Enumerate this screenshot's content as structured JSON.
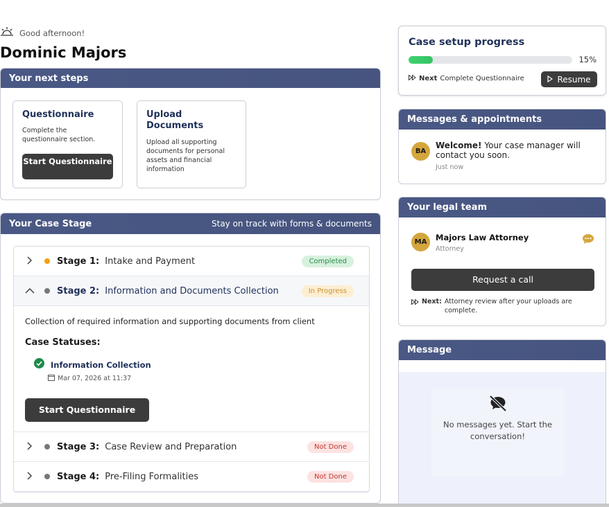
{
  "greeting": "Good afternoon!",
  "user_name": "Dominic Majors",
  "next_steps": {
    "title": "Your next steps",
    "cards": [
      {
        "title": "Questionnaire",
        "desc": "Complete the questionnaire section.",
        "button": "Start Questionnaire"
      },
      {
        "title": "Upload Documents",
        "desc": "Upload all supporting documents for personal assets and financial information"
      }
    ]
  },
  "case_stage": {
    "title": "Your Case Stage",
    "subtitle": "Stay on track with forms & documents",
    "stages": [
      {
        "label": "Stage 1:",
        "name": "Intake and Payment",
        "status": "Completed"
      },
      {
        "label": "Stage 2:",
        "name": "Information and Documents Collection",
        "status": "In Progress"
      },
      {
        "label": "Stage 3:",
        "name": "Case Review and Preparation",
        "status": "Not Done"
      },
      {
        "label": "Stage 4:",
        "name": "Pre-Filing Formalities",
        "status": "Not Done"
      }
    ],
    "expanded": {
      "description": "Collection of required information and supporting documents from client",
      "statuses_title": "Case Statuses:",
      "status_item": "Information Collection",
      "status_date": "Mar 07, 2026 at 11:37",
      "button": "Start Questionnaire"
    }
  },
  "progress": {
    "title": "Case setup progress",
    "percent_label": "15%",
    "percent": 15,
    "next_label": "Next",
    "next_text": "Complete Questionnaire",
    "resume": "Resume"
  },
  "messages": {
    "title": "Messages & appointments",
    "avatar": "BA",
    "welcome_bold": "Welcome!",
    "welcome_text": "Your case manager will contact you soon.",
    "time": "Just now"
  },
  "legal_team": {
    "title": "Your legal team",
    "avatar": "MA",
    "name": "Majors Law Attorney",
    "role": "Attorney",
    "button": "Request a call",
    "next_label": "Next:",
    "next_text": "Attorney review after your uploads are complete."
  },
  "message_panel": {
    "title": "Message",
    "empty_text": "No messages yet. Start the conversation!"
  },
  "colors": {
    "header": "#4a5885",
    "accent_green": "#3ec96b",
    "dark_button": "#3c3c3c",
    "avatar": "#d4a63c"
  }
}
